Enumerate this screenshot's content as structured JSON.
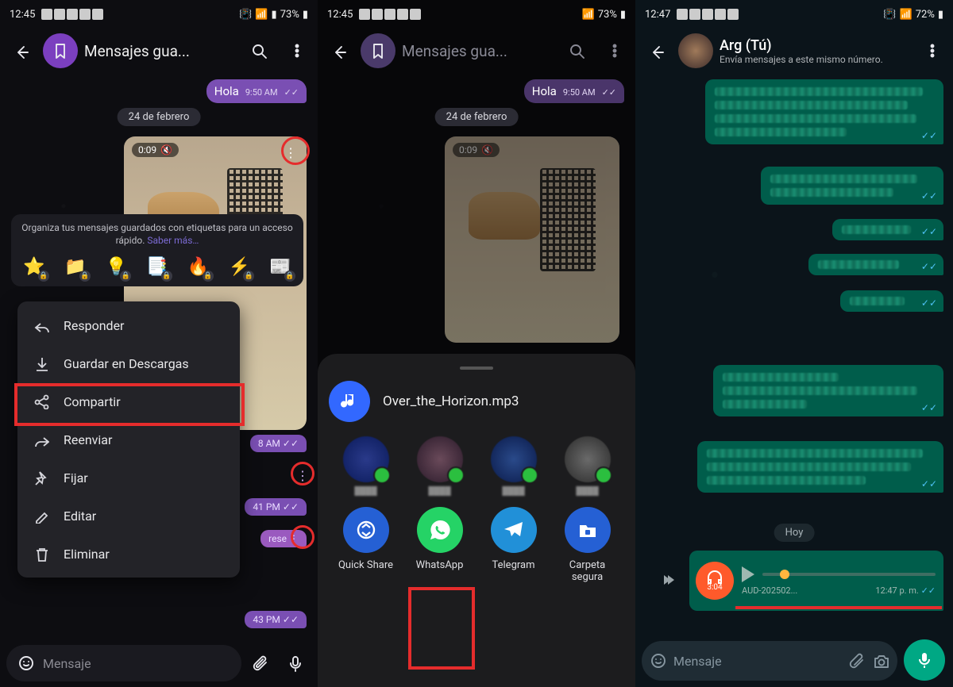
{
  "panel1": {
    "status": {
      "time": "12:45",
      "battery": "73%"
    },
    "header_title": "Mensajes gua...",
    "hola": "Hola",
    "hola_time": "9:50 AM",
    "date": "24 de febrero",
    "video_duration": "0:09",
    "tag_tip_text": "Organiza tus mensajes guardados con etiquetas para un acceso rápido. ",
    "tag_tip_link": "Saber más…",
    "tag_emojis": [
      "⭐",
      "📁",
      "💡",
      "📑",
      "🔥",
      "⚡",
      "📰"
    ],
    "menu": {
      "reply": "Responder",
      "save": "Guardar en Descargas",
      "share": "Compartir",
      "forward": "Reenviar",
      "pin": "Fijar",
      "edit": "Editar",
      "delete": "Eliminar"
    },
    "mini_time1": "8 AM",
    "mini_time2": "41 PM",
    "mini_label": "rese",
    "mini_time3": "43 PM",
    "input_placeholder": "Mensaje"
  },
  "panel2": {
    "status": {
      "time": "12:45",
      "battery": "73%"
    },
    "header_title": "Mensajes gua...",
    "hola": "Hola",
    "hola_time": "9:50 AM",
    "date": "24 de febrero",
    "video_duration": "0:09",
    "file_name": "Over_the_Horizon.mp3",
    "apps": {
      "quickshare": "Quick Share",
      "whatsapp": "WhatsApp",
      "telegram": "Telegram",
      "secure": "Carpeta segura"
    }
  },
  "panel3": {
    "status": {
      "time": "12:47",
      "battery": "72%"
    },
    "header_name": "Arg (Tú)",
    "header_sub": "Envía mensajes a este mismo número.",
    "today": "Hoy",
    "audio_duration": "3:04",
    "audio_file": "AUD-202502...",
    "audio_time": "12:47 p. m.",
    "input_placeholder": "Mensaje"
  }
}
